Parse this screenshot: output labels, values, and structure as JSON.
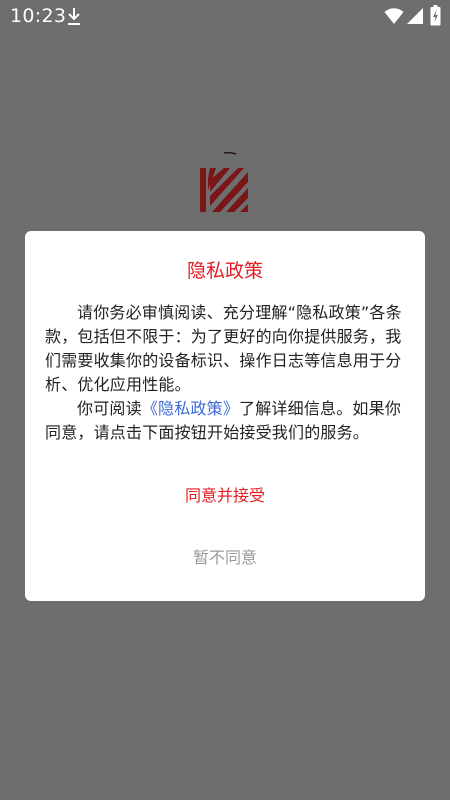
{
  "status_bar": {
    "time": "10:23",
    "icons": [
      "download-icon",
      "wifi-icon",
      "signal-icon",
      "battery-charging-icon"
    ]
  },
  "background": {
    "logo": "app-logo"
  },
  "dialog": {
    "title": "隐私政策",
    "paragraph1": "请你务必审慎阅读、充分理解“隐私政策”各条款，包括但不限于：为了更好的向你提供服务，我们需要收集你的设备标识、操作日志等信息用于分析、优化应用性能。",
    "paragraph2_prefix": "你可阅读",
    "paragraph2_link": "《隐私政策》",
    "paragraph2_suffix": "了解详细信息。如果你同意，请点击下面按钮开始接受我们的服务。",
    "accept_label": "同意并接受",
    "decline_label": "暂不同意"
  },
  "colors": {
    "overlay": "#6e6e6e",
    "accent_red": "#e51c23",
    "link_blue": "#3d6bd6",
    "muted_gray": "#9a9a9a",
    "logo_red": "#7a1518"
  }
}
